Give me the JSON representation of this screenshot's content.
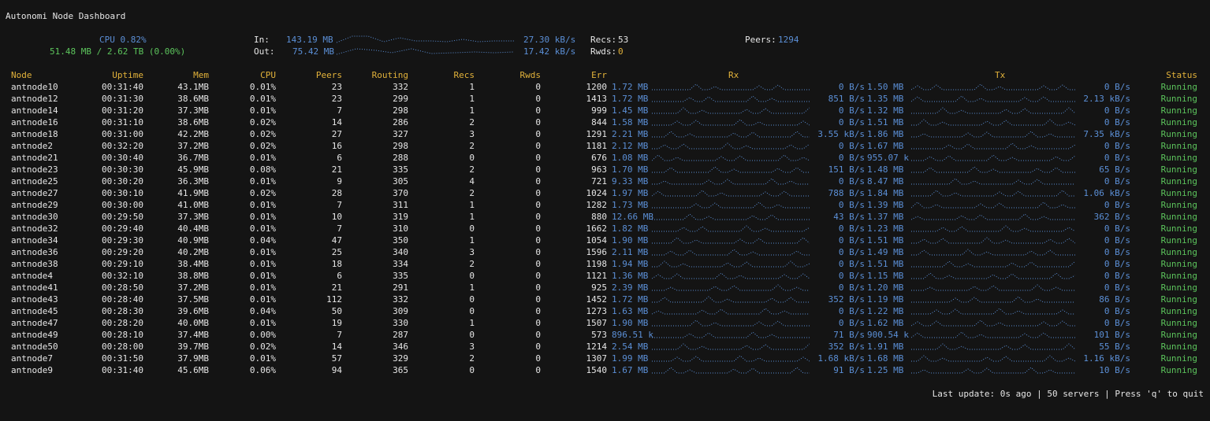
{
  "app": {
    "title": "Autonomi Node Dashboard"
  },
  "summary": {
    "cpu": "CPU 0.82%",
    "mem": "51.48 MB / 2.62 TB (0.00%)",
    "in_label": "In:",
    "in_total": "143.19 MB",
    "in_rate": "27.30 kB/s",
    "out_label": "Out:",
    "out_total": "75.42 MB",
    "out_rate": "17.42 kB/s",
    "recs_label": "Recs:",
    "recs_value": "53",
    "rwds_label": "Rwds:",
    "rwds_value": "0",
    "peers_label": "Peers:",
    "peers_value": "1294"
  },
  "columns": [
    "Node",
    "Uptime",
    "Mem",
    "CPU",
    "Peers",
    "Routing",
    "Recs",
    "Rwds",
    "Err",
    "Rx",
    "Tx",
    "Status"
  ],
  "rows": [
    {
      "node": "antnode10",
      "uptime": "00:31:40",
      "mem": "43.1MB",
      "cpu": "0.01%",
      "peers": "23",
      "routing": "332",
      "recs": "1",
      "rwds": "0",
      "err": "1200",
      "rx_total": "1.72 MB",
      "rx_rate": "0 B/s",
      "tx_total": "1.50 MB",
      "tx_rate": "0 B/s",
      "status": "Running"
    },
    {
      "node": "antnode12",
      "uptime": "00:31:30",
      "mem": "38.6MB",
      "cpu": "0.01%",
      "peers": "23",
      "routing": "299",
      "recs": "1",
      "rwds": "0",
      "err": "1413",
      "rx_total": "1.72 MB",
      "rx_rate": "851 B/s",
      "tx_total": "1.35 MB",
      "tx_rate": "2.13 kB/s",
      "status": "Running"
    },
    {
      "node": "antnode14",
      "uptime": "00:31:20",
      "mem": "37.3MB",
      "cpu": "0.01%",
      "peers": "7",
      "routing": "298",
      "recs": "1",
      "rwds": "0",
      "err": "999",
      "rx_total": "1.45 MB",
      "rx_rate": "0 B/s",
      "tx_total": "1.32 MB",
      "tx_rate": "0 B/s",
      "status": "Running"
    },
    {
      "node": "antnode16",
      "uptime": "00:31:10",
      "mem": "38.6MB",
      "cpu": "0.02%",
      "peers": "14",
      "routing": "286",
      "recs": "2",
      "rwds": "0",
      "err": "844",
      "rx_total": "1.58 MB",
      "rx_rate": "0 B/s",
      "tx_total": "1.51 MB",
      "tx_rate": "0 B/s",
      "status": "Running"
    },
    {
      "node": "antnode18",
      "uptime": "00:31:00",
      "mem": "42.2MB",
      "cpu": "0.02%",
      "peers": "27",
      "routing": "327",
      "recs": "3",
      "rwds": "0",
      "err": "1291",
      "rx_total": "2.21 MB",
      "rx_rate": "3.55 kB/s",
      "tx_total": "1.86 MB",
      "tx_rate": "7.35 kB/s",
      "status": "Running"
    },
    {
      "node": "antnode2",
      "uptime": "00:32:20",
      "mem": "37.2MB",
      "cpu": "0.02%",
      "peers": "16",
      "routing": "298",
      "recs": "2",
      "rwds": "0",
      "err": "1181",
      "rx_total": "2.12 MB",
      "rx_rate": "0 B/s",
      "tx_total": "1.67 MB",
      "tx_rate": "0 B/s",
      "status": "Running"
    },
    {
      "node": "antnode21",
      "uptime": "00:30:40",
      "mem": "36.7MB",
      "cpu": "0.01%",
      "peers": "6",
      "routing": "288",
      "recs": "0",
      "rwds": "0",
      "err": "676",
      "rx_total": "1.08 MB",
      "rx_rate": "0 B/s",
      "tx_total": "955.07 k",
      "tx_rate": "0 B/s",
      "status": "Running"
    },
    {
      "node": "antnode23",
      "uptime": "00:30:30",
      "mem": "45.9MB",
      "cpu": "0.08%",
      "peers": "21",
      "routing": "335",
      "recs": "2",
      "rwds": "0",
      "err": "963",
      "rx_total": "1.70 MB",
      "rx_rate": "151 B/s",
      "tx_total": "1.48 MB",
      "tx_rate": "65 B/s",
      "status": "Running"
    },
    {
      "node": "antnode25",
      "uptime": "00:30:20",
      "mem": "36.3MB",
      "cpu": "0.01%",
      "peers": "9",
      "routing": "305",
      "recs": "4",
      "rwds": "0",
      "err": "721",
      "rx_total": "9.33 MB",
      "rx_rate": "0 B/s",
      "tx_total": "8.47 MB",
      "tx_rate": "0 B/s",
      "status": "Running"
    },
    {
      "node": "antnode27",
      "uptime": "00:30:10",
      "mem": "41.9MB",
      "cpu": "0.02%",
      "peers": "28",
      "routing": "370",
      "recs": "2",
      "rwds": "0",
      "err": "1024",
      "rx_total": "1.97 MB",
      "rx_rate": "788 B/s",
      "tx_total": "1.84 MB",
      "tx_rate": "1.06 kB/s",
      "status": "Running"
    },
    {
      "node": "antnode29",
      "uptime": "00:30:00",
      "mem": "41.0MB",
      "cpu": "0.01%",
      "peers": "7",
      "routing": "311",
      "recs": "1",
      "rwds": "0",
      "err": "1282",
      "rx_total": "1.73 MB",
      "rx_rate": "0 B/s",
      "tx_total": "1.39 MB",
      "tx_rate": "0 B/s",
      "status": "Running"
    },
    {
      "node": "antnode30",
      "uptime": "00:29:50",
      "mem": "37.3MB",
      "cpu": "0.01%",
      "peers": "10",
      "routing": "319",
      "recs": "1",
      "rwds": "0",
      "err": "880",
      "rx_total": "12.66 MB",
      "rx_rate": "43 B/s",
      "tx_total": "1.37 MB",
      "tx_rate": "362 B/s",
      "status": "Running"
    },
    {
      "node": "antnode32",
      "uptime": "00:29:40",
      "mem": "40.4MB",
      "cpu": "0.01%",
      "peers": "7",
      "routing": "310",
      "recs": "0",
      "rwds": "0",
      "err": "1662",
      "rx_total": "1.82 MB",
      "rx_rate": "0 B/s",
      "tx_total": "1.23 MB",
      "tx_rate": "0 B/s",
      "status": "Running"
    },
    {
      "node": "antnode34",
      "uptime": "00:29:30",
      "mem": "40.9MB",
      "cpu": "0.04%",
      "peers": "47",
      "routing": "350",
      "recs": "1",
      "rwds": "0",
      "err": "1054",
      "rx_total": "1.90 MB",
      "rx_rate": "0 B/s",
      "tx_total": "1.51 MB",
      "tx_rate": "0 B/s",
      "status": "Running"
    },
    {
      "node": "antnode36",
      "uptime": "00:29:20",
      "mem": "40.2MB",
      "cpu": "0.01%",
      "peers": "25",
      "routing": "340",
      "recs": "3",
      "rwds": "0",
      "err": "1596",
      "rx_total": "2.11 MB",
      "rx_rate": "0 B/s",
      "tx_total": "1.49 MB",
      "tx_rate": "0 B/s",
      "status": "Running"
    },
    {
      "node": "antnode38",
      "uptime": "00:29:10",
      "mem": "38.4MB",
      "cpu": "0.01%",
      "peers": "18",
      "routing": "334",
      "recs": "2",
      "rwds": "0",
      "err": "1198",
      "rx_total": "1.94 MB",
      "rx_rate": "0 B/s",
      "tx_total": "1.51 MB",
      "tx_rate": "0 B/s",
      "status": "Running"
    },
    {
      "node": "antnode4",
      "uptime": "00:32:10",
      "mem": "38.8MB",
      "cpu": "0.01%",
      "peers": "6",
      "routing": "335",
      "recs": "0",
      "rwds": "0",
      "err": "1121",
      "rx_total": "1.36 MB",
      "rx_rate": "0 B/s",
      "tx_total": "1.15 MB",
      "tx_rate": "0 B/s",
      "status": "Running"
    },
    {
      "node": "antnode41",
      "uptime": "00:28:50",
      "mem": "37.2MB",
      "cpu": "0.01%",
      "peers": "21",
      "routing": "291",
      "recs": "1",
      "rwds": "0",
      "err": "925",
      "rx_total": "2.39 MB",
      "rx_rate": "0 B/s",
      "tx_total": "1.20 MB",
      "tx_rate": "0 B/s",
      "status": "Running"
    },
    {
      "node": "antnode43",
      "uptime": "00:28:40",
      "mem": "37.5MB",
      "cpu": "0.01%",
      "peers": "112",
      "routing": "332",
      "recs": "0",
      "rwds": "0",
      "err": "1452",
      "rx_total": "1.72 MB",
      "rx_rate": "352 B/s",
      "tx_total": "1.19 MB",
      "tx_rate": "86 B/s",
      "status": "Running"
    },
    {
      "node": "antnode45",
      "uptime": "00:28:30",
      "mem": "39.6MB",
      "cpu": "0.04%",
      "peers": "50",
      "routing": "309",
      "recs": "0",
      "rwds": "0",
      "err": "1273",
      "rx_total": "1.63 MB",
      "rx_rate": "0 B/s",
      "tx_total": "1.22 MB",
      "tx_rate": "0 B/s",
      "status": "Running"
    },
    {
      "node": "antnode47",
      "uptime": "00:28:20",
      "mem": "40.0MB",
      "cpu": "0.01%",
      "peers": "19",
      "routing": "330",
      "recs": "1",
      "rwds": "0",
      "err": "1507",
      "rx_total": "1.90 MB",
      "rx_rate": "0 B/s",
      "tx_total": "1.62 MB",
      "tx_rate": "0 B/s",
      "status": "Running"
    },
    {
      "node": "antnode49",
      "uptime": "00:28:10",
      "mem": "37.4MB",
      "cpu": "0.00%",
      "peers": "7",
      "routing": "287",
      "recs": "0",
      "rwds": "0",
      "err": "573",
      "rx_total": "896.51 k",
      "rx_rate": "71 B/s",
      "tx_total": "900.54 k",
      "tx_rate": "101 B/s",
      "status": "Running"
    },
    {
      "node": "antnode50",
      "uptime": "00:28:00",
      "mem": "39.7MB",
      "cpu": "0.02%",
      "peers": "14",
      "routing": "346",
      "recs": "3",
      "rwds": "0",
      "err": "1214",
      "rx_total": "2.54 MB",
      "rx_rate": "352 B/s",
      "tx_total": "1.91 MB",
      "tx_rate": "55 B/s",
      "status": "Running"
    },
    {
      "node": "antnode7",
      "uptime": "00:31:50",
      "mem": "37.9MB",
      "cpu": "0.01%",
      "peers": "57",
      "routing": "329",
      "recs": "2",
      "rwds": "0",
      "err": "1307",
      "rx_total": "1.99 MB",
      "rx_rate": "1.68 kB/s",
      "tx_total": "1.68 MB",
      "tx_rate": "1.16 kB/s",
      "status": "Running"
    },
    {
      "node": "antnode9",
      "uptime": "00:31:40",
      "mem": "45.6MB",
      "cpu": "0.06%",
      "peers": "94",
      "routing": "365",
      "recs": "0",
      "rwds": "0",
      "err": "1540",
      "rx_total": "1.67 MB",
      "rx_rate": "91 B/s",
      "tx_total": "1.25 MB",
      "tx_rate": "10 B/s",
      "status": "Running"
    }
  ],
  "footer": "Last update: 0s ago | 50 servers | Press 'q' to quit",
  "colors": {
    "header": "#e2b23a",
    "net": "#5b8fd6",
    "status": "#5cc45c",
    "text": "#e6e6e6",
    "background": "#141414"
  }
}
